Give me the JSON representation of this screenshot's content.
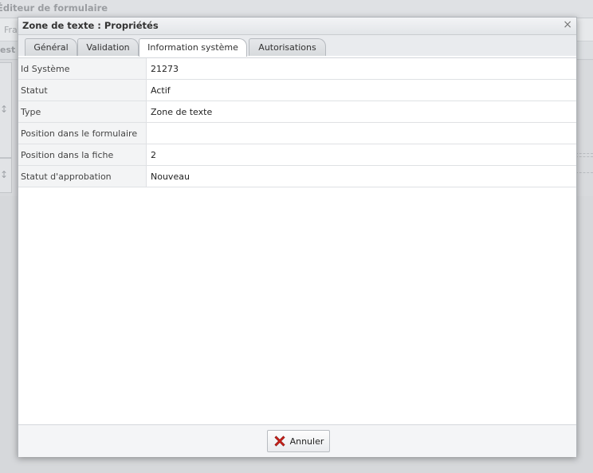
{
  "background": {
    "app_title": "Éditeur de formulaire",
    "toolbar_fragment": "Fra",
    "row_fragment": "est"
  },
  "dialog": {
    "title": "Zone de texte : Propriétés",
    "close_glyph": "×",
    "tabs": [
      {
        "label": "Général",
        "active": false
      },
      {
        "label": "Validation",
        "active": false
      },
      {
        "label": "Information système",
        "active": true
      },
      {
        "label": "Autorisations",
        "active": false
      }
    ],
    "properties": [
      {
        "label": "Id Système",
        "value": "21273"
      },
      {
        "label": "Statut",
        "value": "Actif"
      },
      {
        "label": "Type",
        "value": "Zone de texte"
      },
      {
        "label": "Position dans le formulaire",
        "value": ""
      },
      {
        "label": "Position dans la fiche",
        "value": "2"
      },
      {
        "label": "Statut d'approbation",
        "value": "Nouveau"
      }
    ],
    "cancel_label": "Annuler",
    "cancel_icon": "red-x-icon"
  },
  "colors": {
    "cancel_icon": "#d6221b",
    "backdrop": "#d6d8db"
  }
}
